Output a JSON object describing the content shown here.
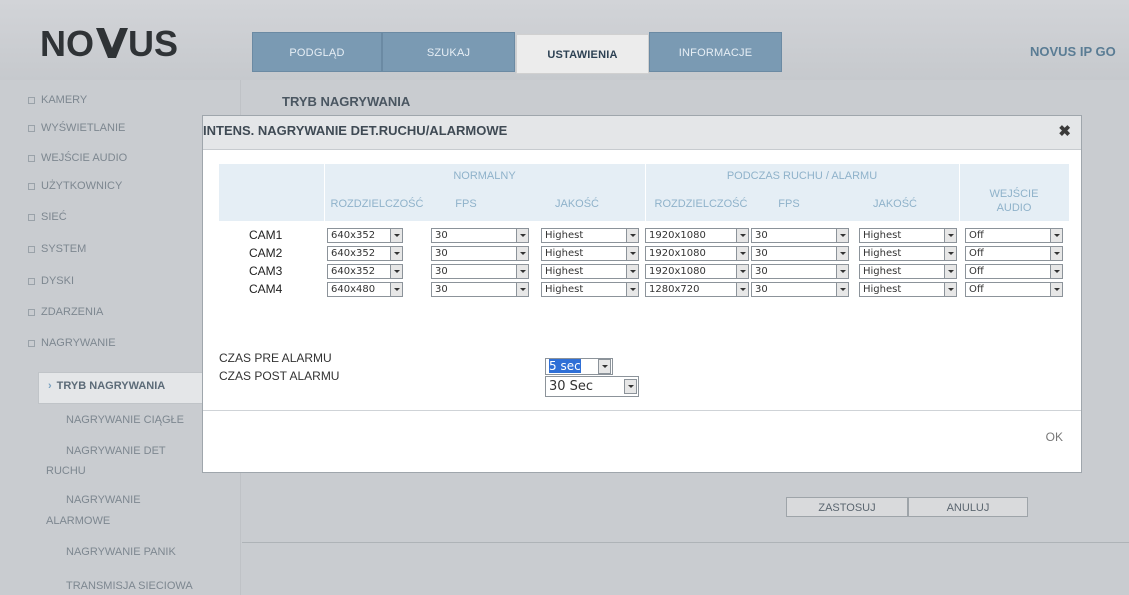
{
  "brand": {
    "logo_text": "NOVUS",
    "right_text": "NOVUS IP GO"
  },
  "tabs": [
    {
      "label": "PODGLĄD",
      "active": false
    },
    {
      "label": "SZUKAJ",
      "active": false
    },
    {
      "label": "USTAWIENIA",
      "active": true
    },
    {
      "label": "INFORMACJE",
      "active": false
    }
  ],
  "sidebar": {
    "items": [
      {
        "label": "KAMERY"
      },
      {
        "label": "WYŚWIETLANIE"
      },
      {
        "label": "WEJŚCIE AUDIO"
      },
      {
        "label": "UŻYTKOWNICY"
      },
      {
        "label": "SIEĆ"
      },
      {
        "label": "SYSTEM"
      },
      {
        "label": "DYSKI"
      },
      {
        "label": "ZDARZENIA"
      },
      {
        "label": "NAGRYWANIE"
      }
    ],
    "subitems": [
      {
        "label": "TRYB NAGRYWANIA",
        "active": true
      },
      {
        "label": "NAGRYWANIE CIĄGŁE"
      },
      {
        "label": "NAGRYWANIE DET"
      },
      {
        "label": "RUCHU"
      },
      {
        "label": "NAGRYWANIE"
      },
      {
        "label": "ALARMOWE"
      },
      {
        "label": "NAGRYWANIE PANIK"
      },
      {
        "label": "TRANSMISJA SIECIOWA"
      }
    ]
  },
  "main": {
    "title": "TRYB NAGRYWANIA",
    "apply_label": "ZASTOSUJ",
    "cancel_label": "ANULUJ"
  },
  "modal": {
    "title": "INTENS. NAGRYWANIE DET.RUCHU/ALARMOWE",
    "close_glyph": "✖",
    "group_normal": "NORMALNY",
    "group_motion": "PODCZAS RUCHU / ALARMU",
    "col_resolution": "ROZDZIELCZOŚĆ",
    "col_fps": "FPS",
    "col_quality": "JAKOŚĆ",
    "col_audio_line1": "WEJŚCIE",
    "col_audio_line2": "AUDIO",
    "rows": [
      {
        "cam": "CAM1",
        "n_res": "640x352",
        "n_fps": "30",
        "n_q": "Highest",
        "m_res": "1920x1080",
        "m_fps": "30",
        "m_q": "Highest",
        "audio": "Off"
      },
      {
        "cam": "CAM2",
        "n_res": "640x352",
        "n_fps": "30",
        "n_q": "Highest",
        "m_res": "1920x1080",
        "m_fps": "30",
        "m_q": "Highest",
        "audio": "Off"
      },
      {
        "cam": "CAM3",
        "n_res": "640x352",
        "n_fps": "30",
        "n_q": "Highest",
        "m_res": "1920x1080",
        "m_fps": "30",
        "m_q": "Highest",
        "audio": "Off"
      },
      {
        "cam": "CAM4",
        "n_res": "640x480",
        "n_fps": "30",
        "n_q": "Highest",
        "m_res": "1280x720",
        "m_fps": "30",
        "m_q": "Highest",
        "audio": "Off"
      }
    ],
    "pre_alarm_label": "CZAS PRE ALARMU",
    "pre_alarm_value": "5 sec",
    "post_alarm_label": "CZAS POST ALARMU",
    "post_alarm_value": "30 Sec",
    "ok_label": "OK"
  },
  "colors": {
    "tab_inactive": "#7a9ab3",
    "tab_active": "#ececec",
    "header_text_blue": "#8fb2ca",
    "selection_highlight": "#2f6fd6"
  }
}
